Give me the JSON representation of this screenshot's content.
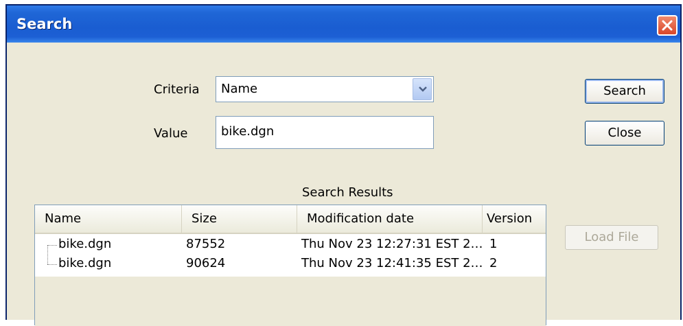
{
  "window": {
    "title": "Search"
  },
  "form": {
    "criteria_label": "Criteria",
    "criteria_value": "Name",
    "value_label": "Value",
    "value_value": "bike.dgn"
  },
  "buttons": {
    "search": "Search",
    "close": "Close",
    "load_file": "Load File"
  },
  "results": {
    "caption": "Search Results",
    "columns": [
      "Name",
      "Size",
      "Modification date",
      "Version"
    ],
    "rows": [
      {
        "name": "bike.dgn",
        "size": "87552",
        "date": "Thu Nov 23 12:27:31 EST 2…",
        "version": "1"
      },
      {
        "name": "bike.dgn",
        "size": "90624",
        "date": "Thu Nov 23 12:41:35 EST 2…",
        "version": "2"
      }
    ]
  },
  "icons": {
    "close": "close-x-icon",
    "dropdown": "chevron-down-icon"
  },
  "colors": {
    "titlebar": "#1a5dd1",
    "dialog_bg": "#ece9d8",
    "close_button": "#d9462a",
    "border": "#7f9db9"
  }
}
